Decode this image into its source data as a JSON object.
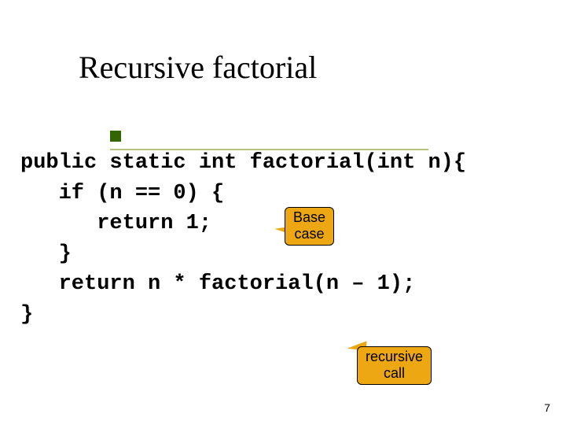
{
  "title": "Recursive factorial",
  "code": {
    "line1": "public static int factorial(int n){",
    "line2": "   if (n == 0) {",
    "line3": "      return 1;",
    "line4": "   }",
    "line5": "   return n * factorial(n – 1);",
    "line6": "}"
  },
  "callouts": {
    "base_case": "Base case",
    "recursive_call": "recursive call"
  },
  "page_number": "7"
}
